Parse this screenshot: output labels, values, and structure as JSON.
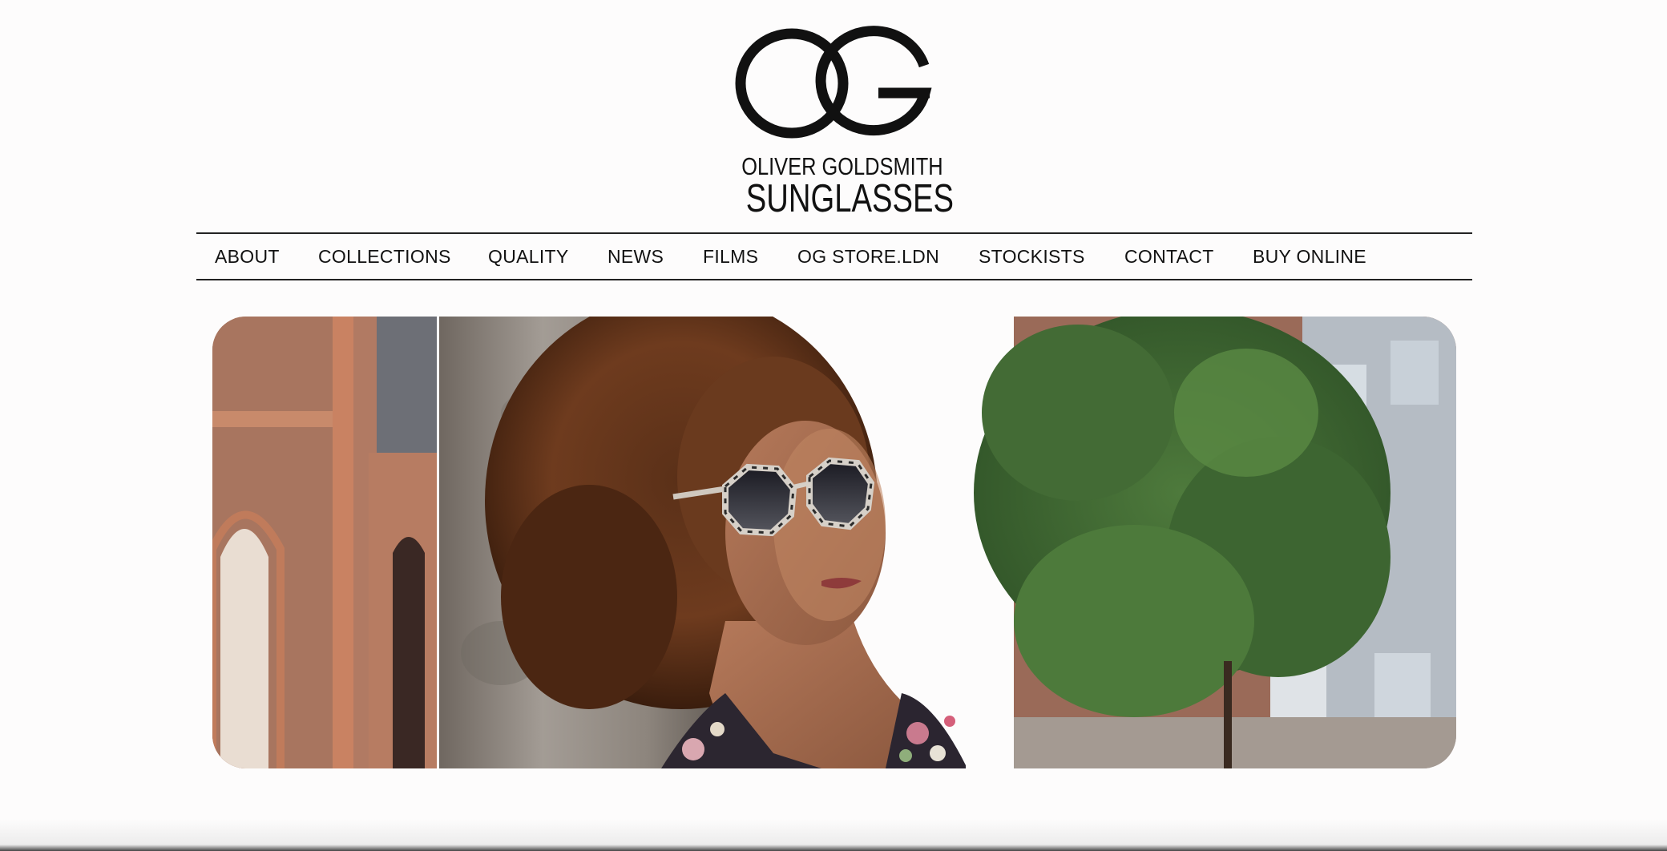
{
  "brand": {
    "monogram": "OG",
    "line1": "OLIVER GOLDSMITH",
    "line2": "SUNGLASSES"
  },
  "nav": {
    "items": [
      {
        "label": "ABOUT"
      },
      {
        "label": "COLLECTIONS"
      },
      {
        "label": "QUALITY"
      },
      {
        "label": "NEWS"
      },
      {
        "label": "FILMS"
      },
      {
        "label": "OG STORE.LDN"
      },
      {
        "label": "STOCKISTS"
      },
      {
        "label": "CONTACT"
      },
      {
        "label": "BUY ONLINE"
      }
    ]
  },
  "hero": {
    "subject": "woman-with-afro-wearing-octagonal-tortoiseshell-sunglasses"
  },
  "colors": {
    "background": "#fdfcfc",
    "text": "#111111",
    "rule": "#222222"
  }
}
